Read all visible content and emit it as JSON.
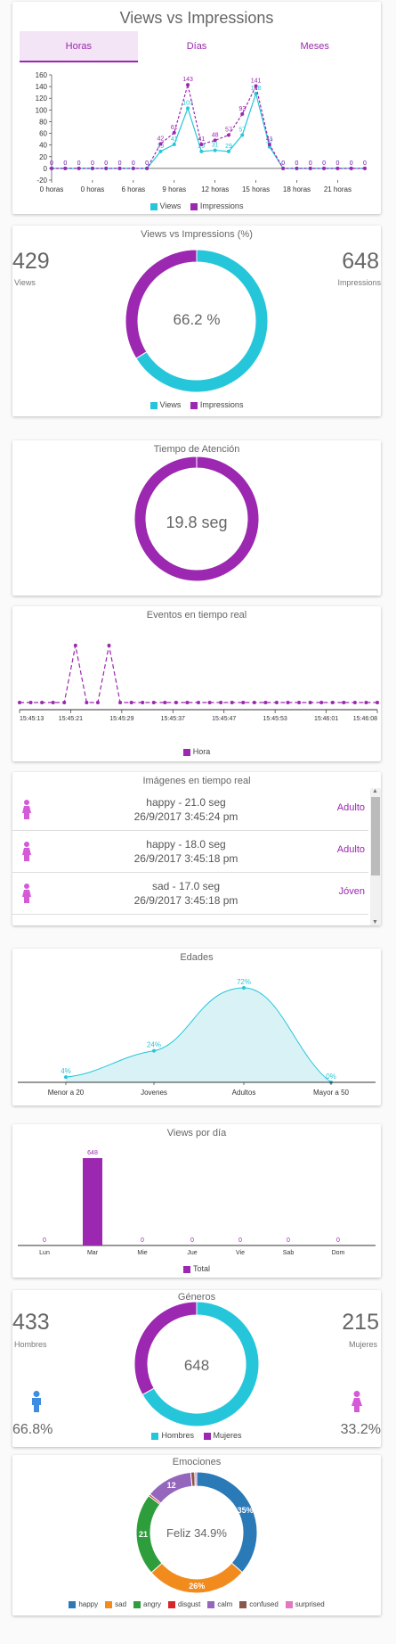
{
  "colors": {
    "purple": "#9c27b0",
    "cyan": "#26c6da",
    "blue": "#2a7ab8",
    "orange": "#f28b1e",
    "green": "#2e9e3c",
    "red": "#d62728",
    "lavender": "#9467bd",
    "brown": "#8c564b",
    "pink": "#e377c2",
    "boy": "#3f8de0",
    "girl": "#d45ad8"
  },
  "views_vs_impressions": {
    "title": "Views vs Impressions",
    "tabs": [
      {
        "label": "Horas"
      },
      {
        "label": "Días"
      },
      {
        "label": "Meses"
      }
    ],
    "legend": {
      "views": "Views",
      "impressions": "Impressions"
    }
  },
  "percent": {
    "title": "Views vs Impressions (%)",
    "views_value": "429",
    "views_label": "Views",
    "impressions_value": "648",
    "impressions_label": "Impressions",
    "center": "66.2 %",
    "legend": {
      "views": "Views",
      "impressions": "Impressions"
    }
  },
  "attention": {
    "title": "Tiempo de Atención",
    "center": "19.8 seg"
  },
  "events": {
    "title": "Eventos en tiempo real",
    "legend": "Hora"
  },
  "images": {
    "title": "Imágenes en tiempo real",
    "rows": [
      {
        "line1": "happy - 21.0 seg",
        "line2": "26/9/2017 3:45:24 pm",
        "age": "Adulto"
      },
      {
        "line1": "happy - 18.0 seg",
        "line2": "26/9/2017 3:45:18 pm",
        "age": "Adulto"
      },
      {
        "line1": "sad - 17.0 seg",
        "line2": "26/9/2017 3:45:18 pm",
        "age": "Jóven"
      }
    ]
  },
  "genders": {
    "title": "Géneros",
    "men_value": "433",
    "men_label": "Hombres",
    "men_pct": "66.8%",
    "women_value": "215",
    "women_label": "Mujeres",
    "women_pct": "33.2%",
    "center": "648",
    "legend": {
      "men": "Hombres",
      "women": "Mujeres"
    }
  },
  "emotions": {
    "title": "Emociones",
    "center": "Feliz 34.9%"
  },
  "chart_data": [
    {
      "type": "line",
      "title": "Views vs Impressions",
      "x": [
        "0 horas",
        "1",
        "2",
        "3",
        "4",
        "5",
        "6",
        "7",
        "8",
        "9",
        "10",
        "11",
        "12",
        "13",
        "14",
        "15",
        "16",
        "17",
        "18",
        "19",
        "20",
        "21",
        "22",
        "23"
      ],
      "x_tick_labels": [
        "0 horas",
        "0 horas",
        "6 horas",
        "9 horas",
        "12 horas",
        "15 horas",
        "18 horas",
        "21 horas"
      ],
      "ylim": [
        -20,
        160
      ],
      "y_ticks": [
        160,
        140,
        120,
        100,
        80,
        60,
        40,
        20,
        0,
        -20
      ],
      "series": [
        {
          "name": "Views",
          "values": [
            0,
            0,
            0,
            0,
            0,
            0,
            0,
            0,
            29,
            41,
            103,
            29,
            31,
            29,
            57,
            128,
            37,
            0,
            0,
            0,
            0,
            0,
            0,
            0
          ]
        },
        {
          "name": "Impressions",
          "values": [
            0,
            0,
            0,
            0,
            0,
            0,
            0,
            0,
            42,
            61,
            143,
            41,
            48,
            57,
            93,
            141,
            41,
            0,
            0,
            0,
            0,
            0,
            0,
            0
          ]
        }
      ]
    },
    {
      "type": "pie",
      "title": "Views vs Impressions (%)",
      "labels": [
        "Views",
        "Impressions"
      ],
      "values": [
        66.2,
        33.8
      ]
    },
    {
      "type": "pie",
      "title": "Tiempo de Atención",
      "labels": [
        "Tiempo"
      ],
      "values": [
        100
      ]
    },
    {
      "type": "line",
      "title": "Eventos en tiempo real",
      "x_tick_labels": [
        "15:45:13",
        "15:45:21",
        "15:45:29",
        "15:45:37",
        "15:45:47",
        "15:45:53",
        "15:46:01",
        "15:46:08"
      ],
      "series": [
        {
          "name": "Hora",
          "values": [
            0,
            0,
            0,
            0,
            0,
            1,
            0,
            0,
            1,
            0,
            0,
            0,
            0,
            0,
            0,
            0,
            0,
            0,
            0,
            0,
            0,
            0,
            0,
            0,
            0,
            0,
            0,
            0,
            0,
            0,
            0,
            0,
            0
          ]
        }
      ]
    },
    {
      "type": "area",
      "title": "Edades",
      "categories": [
        "Menor a 20",
        "Jovenes",
        "Adultos",
        "Mayor a 50"
      ],
      "values": [
        4,
        24,
        72,
        0
      ],
      "data_labels": [
        "4%",
        "24%",
        "72%",
        "0%"
      ]
    },
    {
      "type": "bar",
      "title": "Views por día",
      "categories": [
        "Lun",
        "Mar",
        "Mie",
        "Jue",
        "Vie",
        "Sab",
        "Dom"
      ],
      "series": [
        {
          "name": "Total",
          "values": [
            0,
            648,
            0,
            0,
            0,
            0,
            0
          ]
        }
      ],
      "data_labels": [
        "0",
        "648",
        "0",
        "0",
        "0",
        "0",
        "0"
      ]
    },
    {
      "type": "pie",
      "title": "Géneros",
      "labels": [
        "Hombres",
        "Mujeres"
      ],
      "values": [
        66.8,
        33.2
      ]
    },
    {
      "type": "pie",
      "title": "Emociones",
      "labels": [
        "happy",
        "sad",
        "angry",
        "disgust",
        "calm",
        "confused",
        "surprised"
      ],
      "values": [
        34.9,
        26,
        21,
        0.5,
        12,
        1,
        0.5
      ],
      "data_labels": [
        "35%",
        "26%",
        "21",
        "",
        "12",
        "",
        ""
      ]
    }
  ]
}
